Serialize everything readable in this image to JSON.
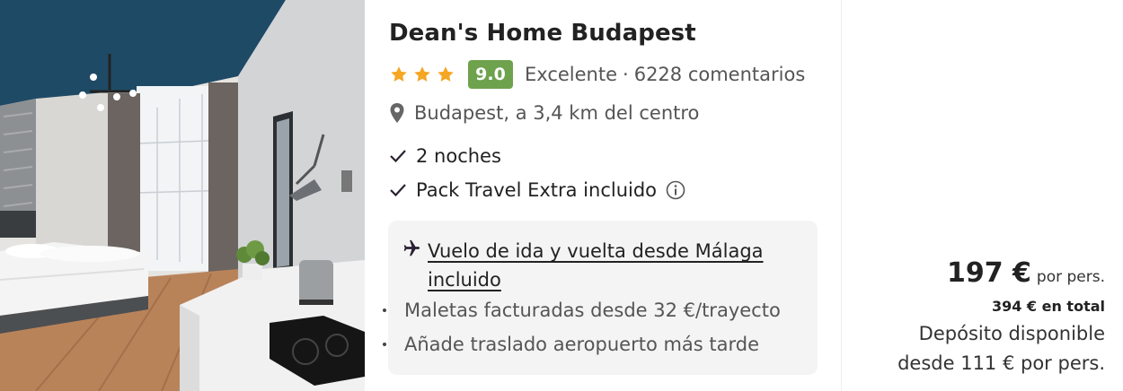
{
  "hotel": {
    "name": "Dean's Home Budapest",
    "stars": 3,
    "score": "9.0",
    "rating_label": "Excelente",
    "reviews": "6228 comentarios",
    "location": "Budapest, a 3,4 km del centro"
  },
  "features": {
    "nights": "2 noches",
    "pack": "Pack Travel Extra incluido"
  },
  "flight": {
    "link": "Vuelo de ida y vuelta desde Málaga incluido",
    "bullets": [
      "Maletas facturadas desde 32 €/trayecto",
      "Añade traslado aeropuerto más tarde"
    ]
  },
  "price": {
    "amount": "197 €",
    "unit": "por pers.",
    "total": "394 € en total",
    "deposit_line1": "Depósito disponible",
    "deposit_line2": "desde 111 € por pers."
  },
  "colors": {
    "score_badge": "#6ea24d",
    "star": "#f5a623",
    "ceiling": "#1f4a66"
  },
  "icons": {
    "star": "star-icon",
    "location": "map-pin-icon",
    "check": "check-icon",
    "info": "info-icon",
    "flight": "airplane-icon"
  }
}
